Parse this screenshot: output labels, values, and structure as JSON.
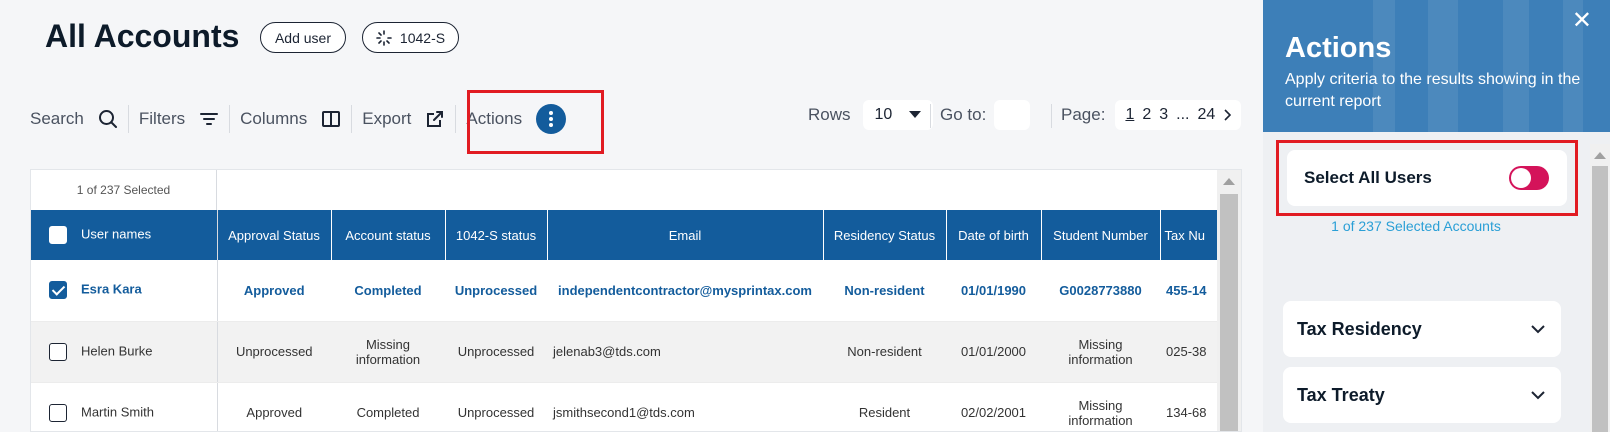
{
  "header": {
    "title": "All Accounts",
    "add_user_label": "Add user",
    "form_label": "1042-S"
  },
  "toolbar": {
    "search_label": "Search",
    "filters_label": "Filters",
    "columns_label": "Columns",
    "export_label": "Export",
    "actions_label": "Actions"
  },
  "pagination": {
    "rows_label": "Rows",
    "rows_value": "10",
    "goto_label": "Go to:",
    "goto_value": "",
    "page_label": "Page:",
    "pages": [
      "1",
      "2",
      "3",
      "...",
      "24"
    ],
    "current_page": "1"
  },
  "table": {
    "selected_text": "1 of 237 Selected",
    "columns": [
      "User names",
      "Approval Status",
      "Account status",
      "1042-S status",
      "Email",
      "Residency Status",
      "Date of birth",
      "Student Number",
      "Tax Nu"
    ],
    "rows": [
      {
        "selected": true,
        "cells": [
          "Esra Kara",
          "Approved",
          "Completed",
          "Unprocessed",
          "independentcontractor@mysprintax.com",
          "Non-resident",
          "01/01/1990",
          "G0028773880",
          "455-14"
        ]
      },
      {
        "selected": false,
        "cells": [
          "Helen Burke",
          "Unprocessed",
          "Missing information",
          "Unprocessed",
          "jelenab3@tds.com",
          "Non-resident",
          "01/01/2000",
          "Missing information",
          "025-38"
        ]
      },
      {
        "selected": false,
        "cells": [
          "Martin Smith",
          "Approved",
          "Completed",
          "Unprocessed",
          "jsmithsecond1@tds.com",
          "Resident",
          "02/02/2001",
          "Missing information",
          "134-68"
        ]
      }
    ]
  },
  "panel": {
    "title": "Actions",
    "subtitle": "Apply criteria to the results showing in the current report",
    "close_icon": "close-icon",
    "select_all_label": "Select All Users",
    "select_all_on": true,
    "selected_accounts": "1 of 237 Selected Accounts",
    "sections": [
      "Tax Residency",
      "Tax Treaty"
    ]
  },
  "colors": {
    "primary": "#135c9c",
    "panel_header": "#3d7fb8",
    "highlight": "#e11b22",
    "toggle": "#d4135a",
    "link": "#2a9fd6"
  }
}
